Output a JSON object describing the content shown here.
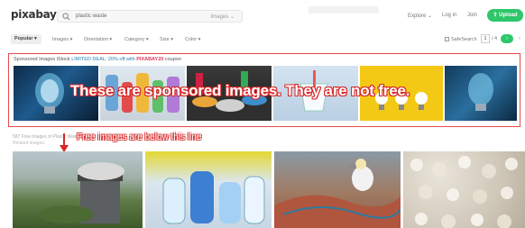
{
  "header": {
    "logo": "pixabay",
    "search_value": "plastic waste",
    "search_type": "Images",
    "links": [
      "Explore",
      "Log in",
      "Join"
    ],
    "upload_label": "Upload"
  },
  "filters": {
    "sort": "Popular",
    "items": [
      "Images",
      "Orientation",
      "Category",
      "Size",
      "Color"
    ],
    "safesearch_label": "SafeSearch",
    "page_current": "1",
    "page_total": "/ 4",
    "next_label": "›"
  },
  "sponsored": {
    "text_prefix": "Sponsored Images iStock ",
    "deal": "LIMITED DEAL: 20% off with ",
    "coupon": "PIXABAY20",
    "text_suffix": " coupon"
  },
  "annotations": {
    "sponsored_overlay": "These are sponsored images. They are not free.",
    "free_overlay": "Free images are below this line"
  },
  "free_section": {
    "count_label": "587 Free images of Plastic Waste",
    "related_label": "Related images:"
  },
  "colors": {
    "brand_green": "#2ec66a",
    "annotation_red": "#e64b4b"
  }
}
